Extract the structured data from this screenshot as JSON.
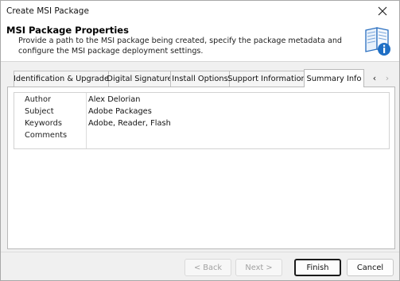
{
  "window": {
    "title": "Create MSI Package"
  },
  "header": {
    "title": "MSI Package Properties",
    "description": "Provide a path to the MSI package being created, specify the package metadata and configure the MSI package deployment settings."
  },
  "tabs": [
    {
      "label": "Identification & Upgrade",
      "active": false
    },
    {
      "label": "Digital Signature",
      "active": false
    },
    {
      "label": "Install Options",
      "active": false
    },
    {
      "label": "Support Information",
      "active": false
    },
    {
      "label": "Summary Info",
      "active": true
    }
  ],
  "tab_scroll": {
    "left": "‹",
    "right": "›"
  },
  "summary": {
    "rows": [
      {
        "key": "Author",
        "value": "Alex Delorian"
      },
      {
        "key": "Subject",
        "value": "Adobe Packages"
      },
      {
        "key": "Keywords",
        "value": "Adobe, Reader, Flash"
      },
      {
        "key": "Comments",
        "value": ""
      }
    ]
  },
  "buttons": {
    "back": "< Back",
    "next": "Next >",
    "finish": "Finish",
    "cancel": "Cancel"
  },
  "icons": {
    "close": "close-icon",
    "header": "book-info-icon"
  },
  "colors": {
    "accent_blue": "#1f6fc5",
    "primary_border": "#1b1b1b"
  }
}
